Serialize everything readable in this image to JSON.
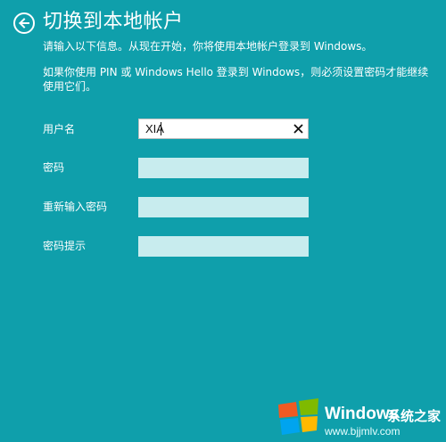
{
  "page": {
    "title": "切换到本地帐户",
    "intro": "请输入以下信息。从现在开始，你将使用本地帐户登录到 Windows。",
    "note": "如果你使用 PIN 或 Windows Hello 登录到 Windows，则必须设置密码才能继续使用它们。"
  },
  "form": {
    "username": {
      "label": "用户名",
      "value": "XIA"
    },
    "password": {
      "label": "密码",
      "value": ""
    },
    "confirm_password": {
      "label": "重新输入密码",
      "value": ""
    },
    "password_hint": {
      "label": "密码提示",
      "value": ""
    }
  },
  "watermark": {
    "brand": "Windows",
    "cn_text": "系统之家",
    "url": "www.bjjmlv.com"
  },
  "colors": {
    "background": "#0f9fab",
    "field_empty": "#c8ecee",
    "text": "#ffffff"
  },
  "icons": {
    "back": "arrow-left-circle",
    "clear": "close-x",
    "logo": "windows-flag"
  }
}
